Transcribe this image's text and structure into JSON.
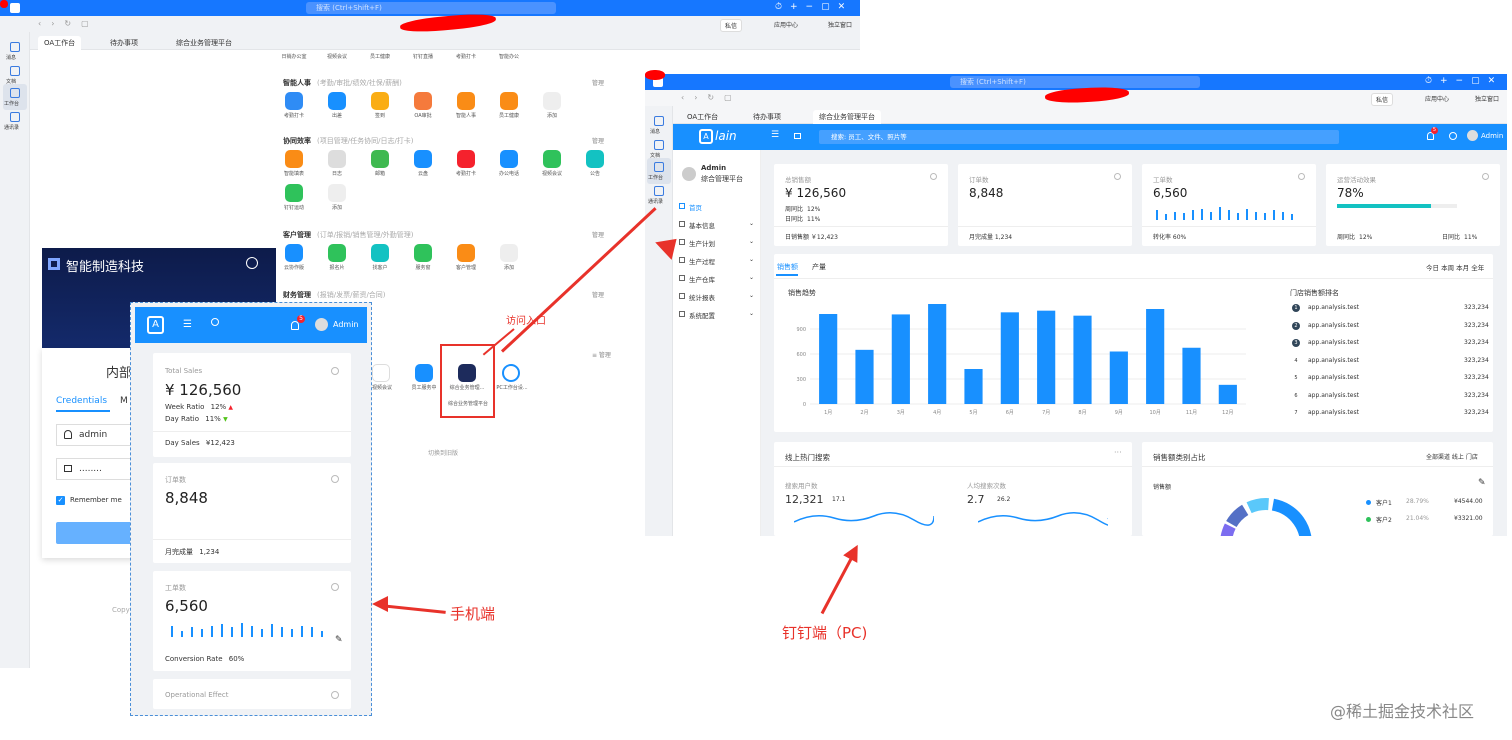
{
  "win1": {
    "search": "搜索 (Ctrl+Shift+F)",
    "badge": "私信",
    "btn_apps": "应用中心",
    "btn_setting": "独立窗口",
    "tabs": [
      "OA工作台",
      "待办事项",
      "综合业务管理平台"
    ],
    "rail": [
      "消息",
      "文档",
      "工作台",
      "通讯录"
    ],
    "top_apps": [
      "日销办公室",
      "视频会议",
      "员工健康",
      "钉钉直播",
      "考勤打卡",
      "智能办公"
    ],
    "sections": [
      {
        "title": "智能人事",
        "sub": "(考勤/审批/绩效/社保/薪酬)",
        "mgr": "管理",
        "apps": [
          "考勤打卡",
          "出差",
          "签到",
          "OA审批",
          "智能人事",
          "员工健康",
          "添加"
        ]
      },
      {
        "title": "协同效率",
        "sub": "(项目管理/任务协同/日志/打卡)",
        "mgr": "管理",
        "apps": [
          "智能填表",
          "日志",
          "邮箱",
          "云盘",
          "考勤打卡",
          "办公电话",
          "视频会议",
          "公告",
          "钉钉运动",
          "添加"
        ]
      },
      {
        "title": "客户管理",
        "sub": "(订单/报销/销售管理/外勤管理)",
        "mgr": "管理",
        "apps": [
          "云协作版",
          "报名片",
          "找客户",
          "服务窗",
          "客户管理",
          "添加"
        ]
      },
      {
        "title": "财务管理",
        "sub": "(报销/发票/薪资/合同)",
        "mgr": "管理",
        "apps": []
      }
    ],
    "bottom_apps": [
      "视频会议",
      "员工服务中",
      "综合业务管理...",
      "PC工作台设..."
    ],
    "access_box": "综合业务管理平台",
    "switch": "切换到旧版"
  },
  "login": {
    "brand": "智能制造科技",
    "heading": "内部",
    "tabs": [
      "Credentials",
      "M"
    ],
    "user": "admin",
    "pwd": "........",
    "remember": "Remember me",
    "copy": "Copy"
  },
  "mobile": {
    "user": "Admin",
    "notif": "5",
    "cards": [
      {
        "title": "Total Sales",
        "value": "¥ 126,560",
        "l1": "Week Ratio",
        "v1": "12%",
        "l2": "Day Ratio",
        "v2": "11%",
        "footer_label": "Day Sales",
        "footer_value": "¥12,423"
      },
      {
        "title": "订单数",
        "value": "8,848",
        "footer_label": "月完成量",
        "footer_value": "1,234"
      },
      {
        "title": "工单数",
        "value": "6,560",
        "footer_label": "Conversion Rate",
        "footer_value": "60%"
      },
      {
        "title": "Operational Effect"
      }
    ],
    "spark": [
      0.7,
      0.4,
      0.6,
      0.5,
      0.7,
      0.8,
      0.6,
      0.9,
      0.7,
      0.5,
      0.8,
      0.6,
      0.5,
      0.7,
      0.6,
      0.4
    ]
  },
  "win2": {
    "search": "搜索 (Ctrl+Shift+F)",
    "badge": "私信",
    "btn_apps": "应用中心",
    "btn_setting": "独立窗口",
    "tabs": [
      "OA工作台",
      "待办事项",
      "综合业务管理平台"
    ],
    "rail": [
      "消息",
      "文档",
      "工作台",
      "通讯录"
    ],
    "logo": "lain",
    "search2": "搜索: 员工、文件、照片等",
    "admin": "Admin",
    "notif": "5",
    "profile_name": "Admin",
    "profile_org": "综合管理平台",
    "menu": [
      "首页",
      "基本信息",
      "生产计划",
      "生产过程",
      "生产仓库",
      "统计报表",
      "系统配置"
    ],
    "stats": [
      {
        "title": "总销售额",
        "value": "¥ 126,560",
        "l1": "周同比",
        "v1": "12%",
        "l2": "日同比",
        "v2": "11%",
        "footer": "日销售额 ￥12,423"
      },
      {
        "title": "订单数",
        "value": "8,848",
        "footer": "月完成量  1,234"
      },
      {
        "title": "工单数",
        "value": "6,560",
        "footer": "转化率  60%"
      },
      {
        "title": "运营活动效果",
        "value": "78%",
        "l1": "周同比",
        "v1": "12%",
        "l2": "日同比",
        "v2": "11%",
        "progress": 0.78
      }
    ],
    "tab_sales": "销售额",
    "tab_qty": "产量",
    "period": "今日 本周 本月 全年",
    "chart_title": "销售趋势",
    "rank_title": "门店销售额排名",
    "rank": [
      {
        "n": "1",
        "name": "app.analysis.test",
        "v": "323,234"
      },
      {
        "n": "2",
        "name": "app.analysis.test",
        "v": "323,234"
      },
      {
        "n": "3",
        "name": "app.analysis.test",
        "v": "323,234"
      },
      {
        "n": "4",
        "name": "app.analysis.test",
        "v": "323,234"
      },
      {
        "n": "5",
        "name": "app.analysis.test",
        "v": "323,234"
      },
      {
        "n": "6",
        "name": "app.analysis.test",
        "v": "323,234"
      },
      {
        "n": "7",
        "name": "app.analysis.test",
        "v": "323,234"
      }
    ],
    "hot_title": "线上热门搜索",
    "hot_l1": "搜索用户数",
    "hot_v1": "12,321",
    "hot_r1": "17.1",
    "hot_l2": "人均搜索次数",
    "hot_v2": "2.7",
    "hot_r2": "26.2",
    "cat_title": "销售额类别占比",
    "cat_opts": "全部渠道 线上 门店",
    "cat_sub": "销售额",
    "legend": [
      {
        "name": "客户1",
        "pct": "28.79%",
        "val": "¥4544.00",
        "color": "#1890ff"
      },
      {
        "name": "客户2",
        "pct": "21.04%",
        "val": "¥3321.00",
        "color": "#2fc25b"
      }
    ]
  },
  "chart_data": {
    "type": "bar",
    "categories": [
      "1月",
      "2月",
      "3月",
      "4月",
      "5月",
      "6月",
      "7月",
      "8月",
      "9月",
      "10月",
      "11月",
      "12月"
    ],
    "values": [
      1080,
      650,
      1075,
      1200,
      420,
      1100,
      1120,
      1060,
      630,
      1140,
      675,
      230
    ],
    "yticks": [
      "0",
      "300",
      "600",
      "900"
    ],
    "ylim": [
      0,
      1200
    ]
  },
  "annotations": {
    "access": "访问入口",
    "mobile": "手机端",
    "pc": "钉钉端（PC)",
    "watermark": "@稀土掘金技术社区"
  },
  "colors": {
    "primary": "#1677ff",
    "accent": "#1890ff",
    "red": "#e8322a"
  }
}
